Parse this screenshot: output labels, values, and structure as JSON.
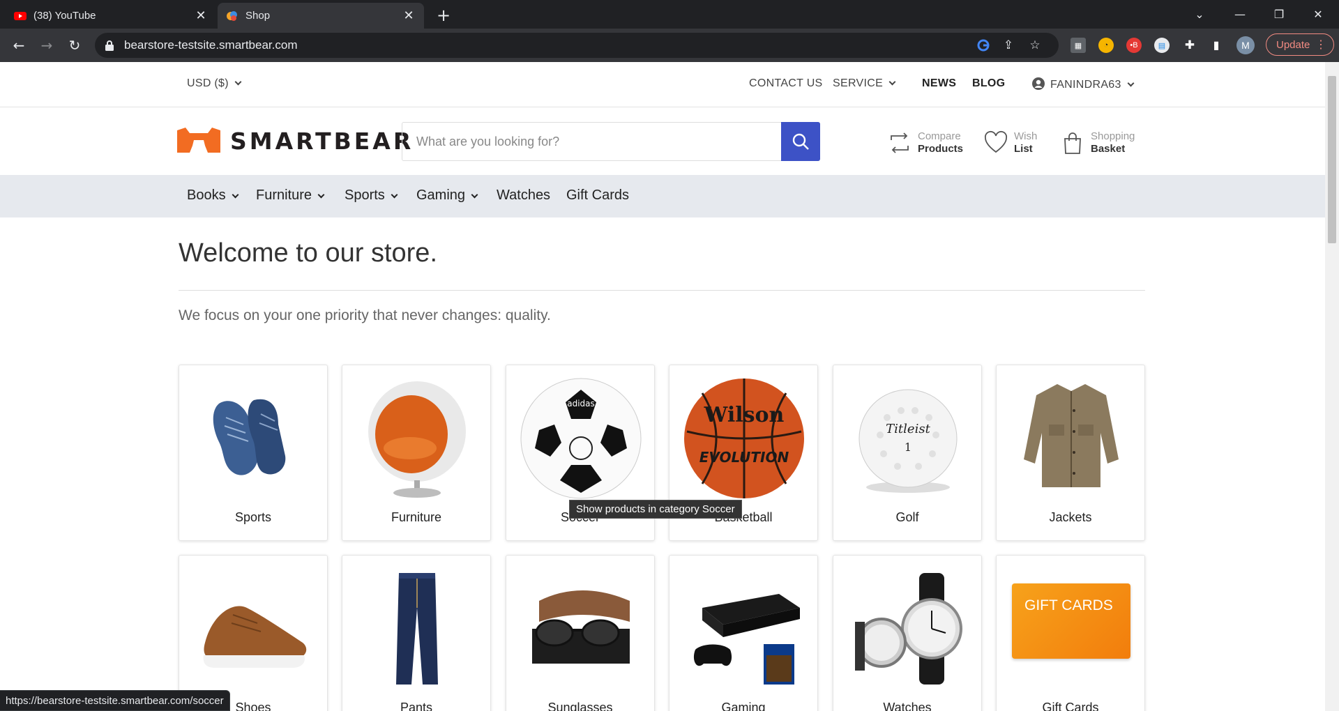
{
  "browser": {
    "tabs": [
      {
        "label": "(38) YouTube",
        "icon": "youtube-icon"
      },
      {
        "label": "Shop",
        "icon": "shop-favicon"
      }
    ],
    "url": "bearstore-testsite.smartbear.com",
    "update_label": "Update",
    "profile_initial": "M",
    "status_url": "https://bearstore-testsite.smartbear.com/soccer"
  },
  "topbar": {
    "currency": "USD  ($)",
    "contact": "CONTACT US",
    "service": "SERVICE",
    "news": "NEWS",
    "blog": "BLOG",
    "user": "FANINDRA63"
  },
  "header": {
    "logo_text": "SMARTBEAR",
    "search_placeholder": "What are you looking for?",
    "compare_top": "Compare",
    "compare_bottom": "Products",
    "wish_top": "Wish",
    "wish_bottom": "List",
    "basket_top": "Shopping",
    "basket_bottom": "Basket"
  },
  "menu": {
    "items": [
      "Books",
      "Furniture",
      "Sports",
      "Gaming",
      "Watches",
      "Gift Cards"
    ]
  },
  "main": {
    "title": "Welcome to our store.",
    "tagline": "We focus on your one priority that never changes: quality.",
    "categories": [
      "Sports",
      "Furniture",
      "Soccer",
      "Basketball",
      "Golf",
      "Jackets",
      "Shoes",
      "Pants",
      "Sunglasses",
      "Gaming",
      "Watches",
      "Gift Cards"
    ],
    "gift_card_text": "GIFT CARDS"
  },
  "tooltip": "Show products in category Soccer",
  "colors": {
    "brand_orange": "#f26c22",
    "search_button": "#3d52c6",
    "menu_bg": "#e6e9ee"
  }
}
